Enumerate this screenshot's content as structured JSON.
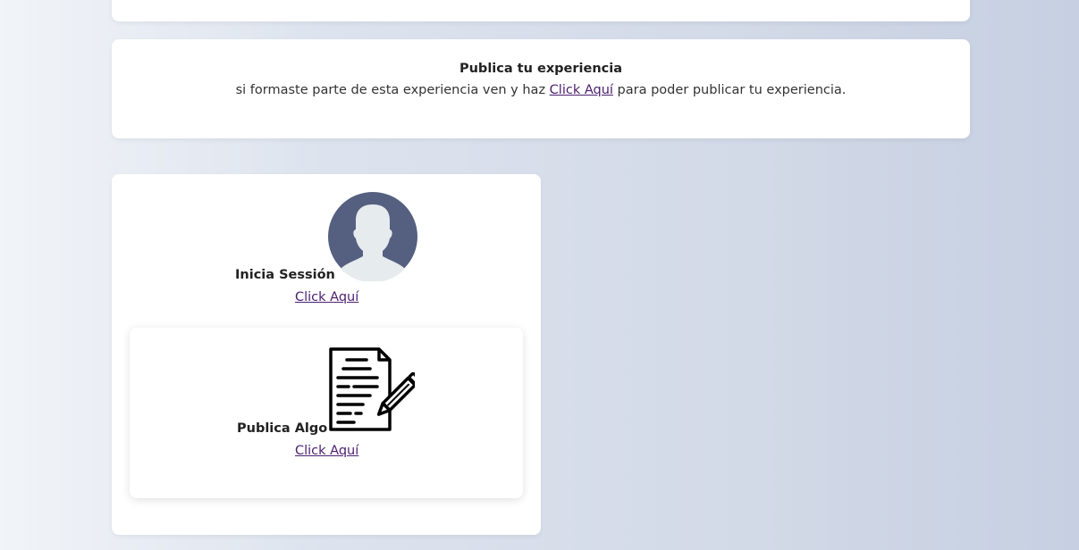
{
  "publish_section": {
    "title": "Publica tu experiencia",
    "text_before": "si formaste parte de esta experiencia ven y haz ",
    "link_label": "Click Aquí",
    "text_after": " para poder publicar tu experiencia."
  },
  "login_section": {
    "label": "Inicia Sessión",
    "link_label": "Click Aquí",
    "avatar_icon": "user-avatar-icon"
  },
  "post_section": {
    "label": "Publica Algo",
    "link_label": "Click Aquí",
    "icon": "document-pencil-icon"
  },
  "colors": {
    "link": "#4b1f6f",
    "avatar_bg": "#556080",
    "avatar_figure": "#e6ebee"
  }
}
